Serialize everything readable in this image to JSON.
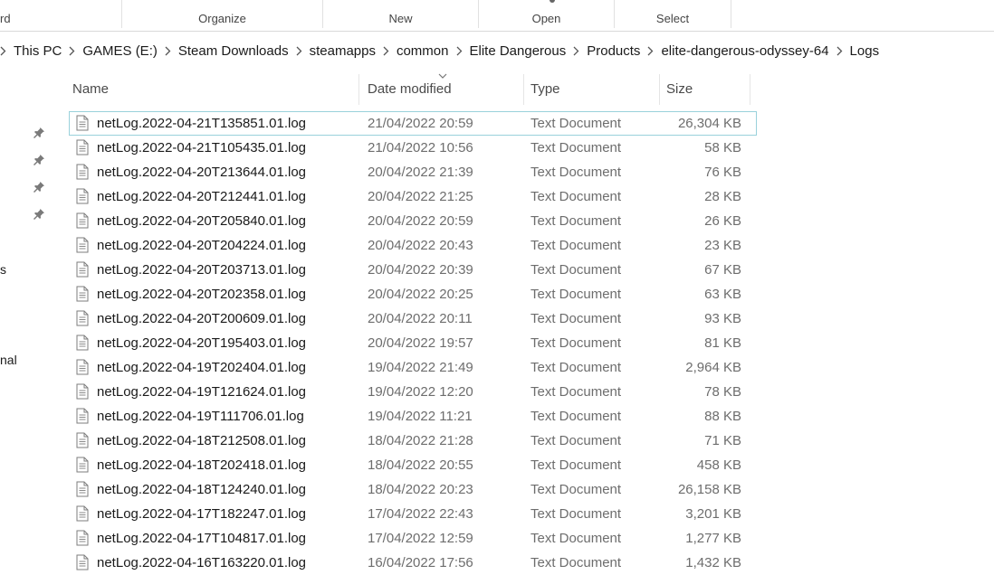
{
  "ribbon": {
    "groups": [
      {
        "label": "rd"
      },
      {
        "label": "Organize"
      },
      {
        "label": "New"
      },
      {
        "label": "Open"
      },
      {
        "label": "Select"
      }
    ]
  },
  "breadcrumb": {
    "items": [
      "This PC",
      "GAMES (E:)",
      "Steam Downloads",
      "steamapps",
      "common",
      "Elite Dangerous",
      "Products",
      "elite-dangerous-odyssey-64",
      "Logs"
    ]
  },
  "nav": {
    "fragments": [
      "s",
      "nal"
    ]
  },
  "columns": {
    "name": "Name",
    "date": "Date modified",
    "type": "Type",
    "size": "Size"
  },
  "files": [
    {
      "name": "netLog.2022-04-21T135851.01.log",
      "date": "21/04/2022 20:59",
      "type": "Text Document",
      "size": "26,304 KB",
      "selected": true
    },
    {
      "name": "netLog.2022-04-21T105435.01.log",
      "date": "21/04/2022 10:56",
      "type": "Text Document",
      "size": "58 KB"
    },
    {
      "name": "netLog.2022-04-20T213644.01.log",
      "date": "20/04/2022 21:39",
      "type": "Text Document",
      "size": "76 KB"
    },
    {
      "name": "netLog.2022-04-20T212441.01.log",
      "date": "20/04/2022 21:25",
      "type": "Text Document",
      "size": "28 KB"
    },
    {
      "name": "netLog.2022-04-20T205840.01.log",
      "date": "20/04/2022 20:59",
      "type": "Text Document",
      "size": "26 KB"
    },
    {
      "name": "netLog.2022-04-20T204224.01.log",
      "date": "20/04/2022 20:43",
      "type": "Text Document",
      "size": "23 KB"
    },
    {
      "name": "netLog.2022-04-20T203713.01.log",
      "date": "20/04/2022 20:39",
      "type": "Text Document",
      "size": "67 KB"
    },
    {
      "name": "netLog.2022-04-20T202358.01.log",
      "date": "20/04/2022 20:25",
      "type": "Text Document",
      "size": "63 KB"
    },
    {
      "name": "netLog.2022-04-20T200609.01.log",
      "date": "20/04/2022 20:11",
      "type": "Text Document",
      "size": "93 KB"
    },
    {
      "name": "netLog.2022-04-20T195403.01.log",
      "date": "20/04/2022 19:57",
      "type": "Text Document",
      "size": "81 KB"
    },
    {
      "name": "netLog.2022-04-19T202404.01.log",
      "date": "19/04/2022 21:49",
      "type": "Text Document",
      "size": "2,964 KB"
    },
    {
      "name": "netLog.2022-04-19T121624.01.log",
      "date": "19/04/2022 12:20",
      "type": "Text Document",
      "size": "78 KB"
    },
    {
      "name": "netLog.2022-04-19T111706.01.log",
      "date": "19/04/2022 11:21",
      "type": "Text Document",
      "size": "88 KB"
    },
    {
      "name": "netLog.2022-04-18T212508.01.log",
      "date": "18/04/2022 21:28",
      "type": "Text Document",
      "size": "71 KB"
    },
    {
      "name": "netLog.2022-04-18T202418.01.log",
      "date": "18/04/2022 20:55",
      "type": "Text Document",
      "size": "458 KB"
    },
    {
      "name": "netLog.2022-04-18T124240.01.log",
      "date": "18/04/2022 20:23",
      "type": "Text Document",
      "size": "26,158 KB"
    },
    {
      "name": "netLog.2022-04-17T182247.01.log",
      "date": "17/04/2022 22:43",
      "type": "Text Document",
      "size": "3,201 KB"
    },
    {
      "name": "netLog.2022-04-17T104817.01.log",
      "date": "17/04/2022 12:59",
      "type": "Text Document",
      "size": "1,277 KB"
    },
    {
      "name": "netLog.2022-04-16T163220.01.log",
      "date": "16/04/2022 17:56",
      "type": "Text Document",
      "size": "1,432 KB"
    }
  ],
  "colors": {
    "selection_outline": "#99d1db",
    "secondary_text": "#6d6d6d",
    "header_text": "#4a4a4a"
  }
}
